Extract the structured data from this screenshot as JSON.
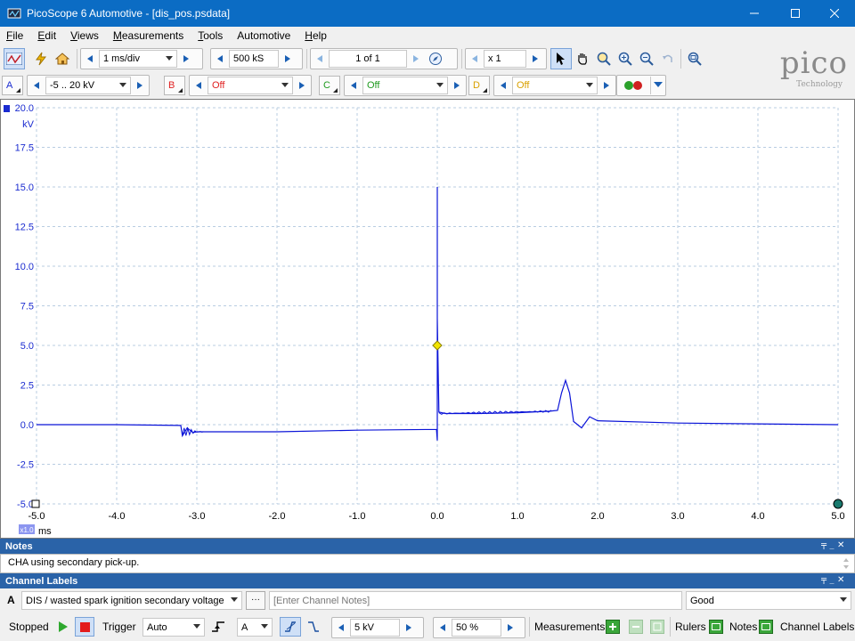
{
  "window": {
    "title": "PicoScope 6 Automotive - [dis_pos.psdata]"
  },
  "menu": [
    {
      "label": "File",
      "ul": "F",
      "rest": "ile"
    },
    {
      "label": "Edit",
      "ul": "E",
      "rest": "dit"
    },
    {
      "label": "Views",
      "ul": "V",
      "rest": "iews"
    },
    {
      "label": "Measurements",
      "ul": "M",
      "rest": "easurements"
    },
    {
      "label": "Tools",
      "ul": "T",
      "rest": "ools"
    },
    {
      "label": "Automotive",
      "ul": "",
      "rest": "Automotive"
    },
    {
      "label": "Help",
      "ul": "H",
      "rest": "elp"
    }
  ],
  "toolbar": {
    "timebase": "1 ms/div",
    "samples": "500 kS",
    "buffer": "1 of 1",
    "zoom": "x 1"
  },
  "channels": {
    "a": {
      "letter": "A",
      "range": "-5 .. 20 kV"
    },
    "b": {
      "letter": "B",
      "range": "Off"
    },
    "c": {
      "letter": "C",
      "range": "Off"
    },
    "d": {
      "letter": "D",
      "range": "Off"
    }
  },
  "logo": {
    "brand": "pico",
    "sub": "Technology"
  },
  "scope": {
    "y_unit": "kV",
    "x_unit": "ms",
    "x_zoom_badge": "x1.0",
    "y_ticks": [
      "20.0",
      "17.5",
      "15.0",
      "12.5",
      "10.0",
      "7.5",
      "5.0",
      "2.5",
      "0.0",
      "-2.5",
      "-5.0"
    ],
    "x_ticks": [
      "-5.0",
      "-4.0",
      "-3.0",
      "-2.0",
      "-1.0",
      "0.0",
      "1.0",
      "2.0",
      "3.0",
      "4.0",
      "5.0"
    ],
    "trace_color": "#0b14d8",
    "trigger_color": "#f2e400"
  },
  "chart_data": {
    "type": "line",
    "xlabel": "ms",
    "ylabel": "kV",
    "xlim": [
      -5.0,
      5.0
    ],
    "ylim": [
      -5.0,
      20.0
    ],
    "grid": true,
    "series": [
      {
        "x": [
          -5.0,
          -4.0,
          -3.2,
          -3.18,
          -3.12,
          -3.05,
          -3.0,
          -2.0,
          -1.0,
          -0.01,
          0.0,
          0.0,
          0.0,
          0.02,
          0.1,
          0.5,
          1.0,
          1.4,
          1.5,
          1.55,
          1.6,
          1.65,
          1.7,
          1.8,
          1.9,
          2.0,
          3.0,
          4.0,
          5.0
        ],
        "y": [
          0.0,
          0.0,
          -0.05,
          -0.7,
          -0.2,
          -0.5,
          -0.45,
          -0.45,
          -0.35,
          -0.3,
          -1.0,
          15.0,
          6.7,
          0.8,
          0.7,
          0.7,
          0.75,
          0.85,
          0.9,
          2.0,
          2.8,
          2.0,
          0.2,
          -0.2,
          0.5,
          0.25,
          0.1,
          0.05,
          0.0
        ]
      }
    ],
    "trigger": {
      "x": 0.0,
      "y": 5.0
    }
  },
  "notes": {
    "header": "Notes",
    "text": "CHA using secondary pick-up."
  },
  "channel_labels": {
    "header": "Channel Labels",
    "channel": "A",
    "label": "DIS / wasted spark ignition secondary voltage",
    "notes_placeholder": "[Enter Channel Notes]",
    "status": "Good",
    "browse": "···"
  },
  "statusbar": {
    "state": "Stopped",
    "trigger_label": "Trigger",
    "trigger_mode": "Auto",
    "trigger_channel": "A",
    "trigger_level": "5 kV",
    "pretrigger": "50 %",
    "measurements": "Measurements",
    "rulers": "Rulers",
    "notes": "Notes",
    "channel_labels": "Channel Labels"
  }
}
